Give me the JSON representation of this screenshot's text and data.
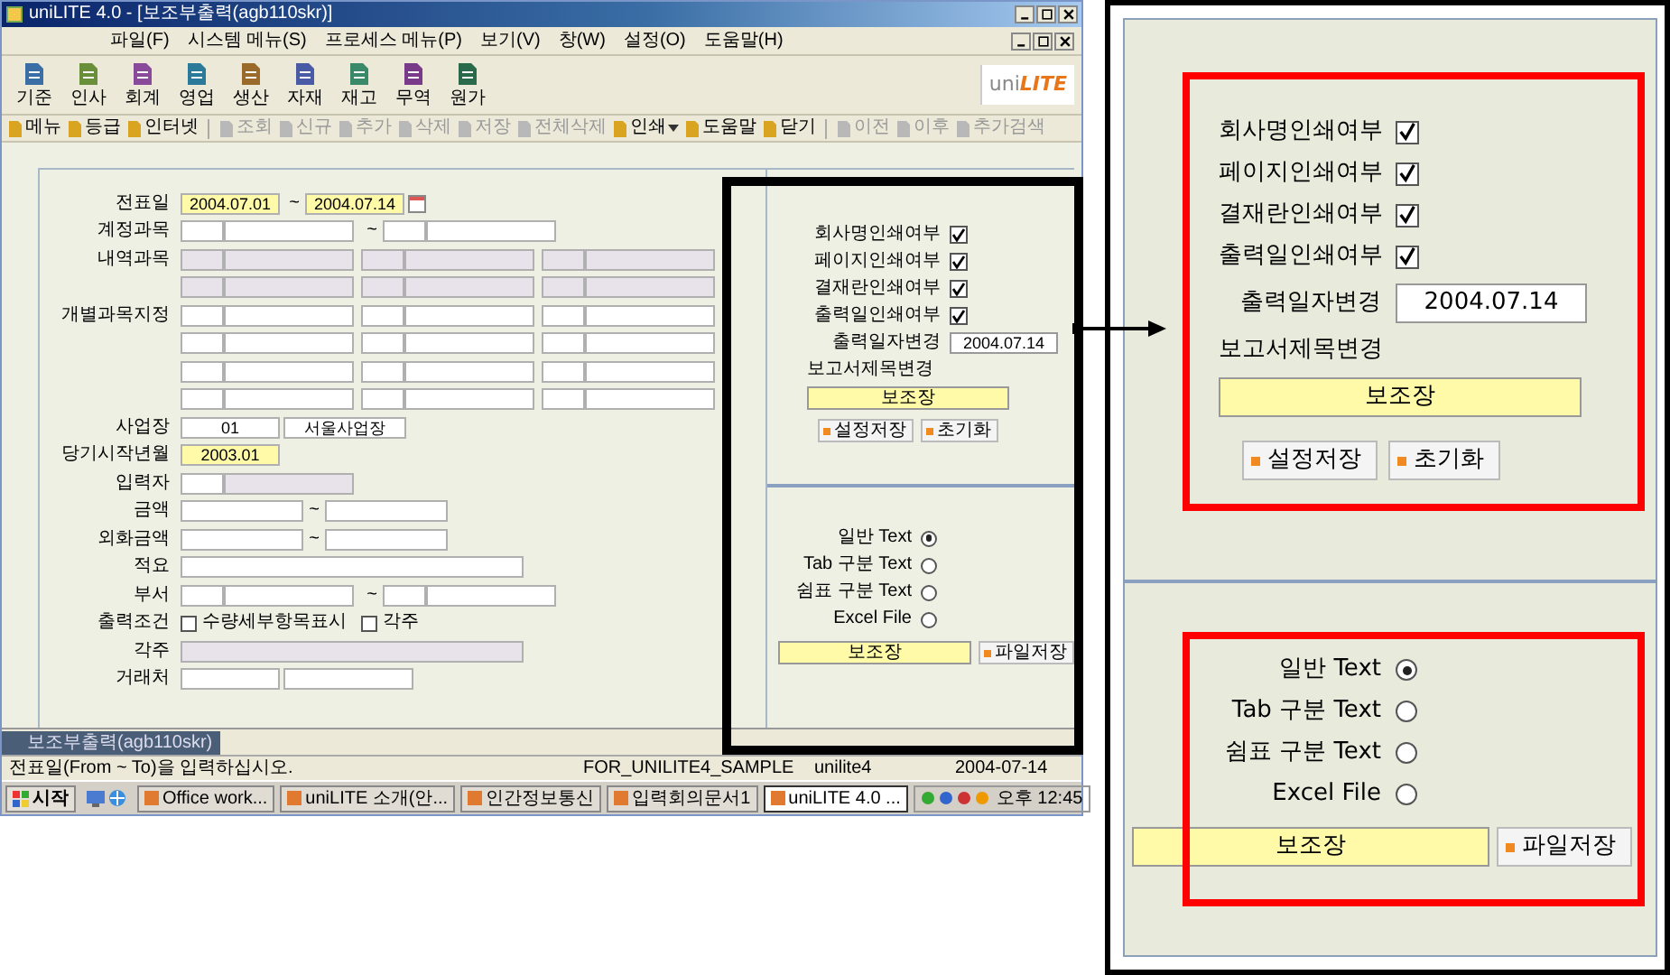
{
  "app_window": {
    "title": "uniLITE 4.0 - [보조부출력(agb110skr)]",
    "menu": [
      "파일(F)",
      "시스템 메뉴(S)",
      "프로세스 메뉴(P)",
      "보기(V)",
      "창(W)",
      "설정(O)",
      "도움말(H)"
    ],
    "modules": [
      "기준",
      "인사",
      "회계",
      "영업",
      "생산",
      "자재",
      "재고",
      "무역",
      "원가"
    ],
    "logo": [
      "uni",
      "LITE"
    ],
    "toolbar": [
      {
        "kind": "button",
        "label": "메뉴",
        "disabled": false
      },
      {
        "kind": "button",
        "label": "등급",
        "disabled": false
      },
      {
        "kind": "button",
        "label": "인터넷",
        "disabled": false
      },
      {
        "kind": "separator"
      },
      {
        "kind": "button",
        "label": "조회",
        "disabled": true
      },
      {
        "kind": "button",
        "label": "신규",
        "disabled": true
      },
      {
        "kind": "button",
        "label": "추가",
        "disabled": true
      },
      {
        "kind": "button",
        "label": "삭제",
        "disabled": true
      },
      {
        "kind": "button",
        "label": "저장",
        "disabled": true
      },
      {
        "kind": "button",
        "label": "전체삭제",
        "disabled": true
      },
      {
        "kind": "dropdown",
        "label": "인쇄",
        "disabled": false
      },
      {
        "kind": "button",
        "label": "도움말",
        "disabled": false
      },
      {
        "kind": "button",
        "label": "닫기",
        "disabled": false
      },
      {
        "kind": "separator"
      },
      {
        "kind": "button",
        "label": "이전",
        "disabled": true
      },
      {
        "kind": "button",
        "label": "이후",
        "disabled": true
      },
      {
        "kind": "button",
        "label": "추가검색",
        "disabled": true
      }
    ],
    "form": {
      "rows": [
        {
          "label": "전표일",
          "items": [
            {
              "kind": "date",
              "value": "2004.07.01",
              "required": true
            },
            {
              "kind": "sep",
              "text": "~"
            },
            {
              "kind": "date",
              "value": "2004.07.14",
              "required": true
            },
            {
              "kind": "calendar"
            }
          ]
        },
        {
          "label": "계정과목",
          "items": [
            {
              "kind": "code"
            },
            {
              "kind": "name"
            },
            {
              "kind": "sep",
              "text": "~"
            },
            {
              "kind": "code"
            },
            {
              "kind": "name"
            }
          ]
        },
        {
          "label": "내역과목",
          "items": [
            {
              "kind": "code",
              "disabled": true
            },
            {
              "kind": "name",
              "disabled": true
            },
            {
              "kind": "code",
              "disabled": true
            },
            {
              "kind": "name",
              "disabled": true
            },
            {
              "kind": "code",
              "disabled": true
            },
            {
              "kind": "name",
              "disabled": true
            }
          ]
        },
        {
          "items": [
            {
              "kind": "code",
              "disabled": true
            },
            {
              "kind": "name",
              "disabled": true
            },
            {
              "kind": "code",
              "disabled": true
            },
            {
              "kind": "name",
              "disabled": true
            },
            {
              "kind": "code",
              "disabled": true
            },
            {
              "kind": "name",
              "disabled": true
            }
          ]
        },
        {
          "label": "개별과목지정",
          "items": [
            {
              "kind": "code"
            },
            {
              "kind": "name"
            },
            {
              "kind": "code"
            },
            {
              "kind": "name"
            },
            {
              "kind": "code"
            },
            {
              "kind": "name"
            }
          ]
        },
        {
          "items": [
            {
              "kind": "code"
            },
            {
              "kind": "name"
            },
            {
              "kind": "code"
            },
            {
              "kind": "name"
            },
            {
              "kind": "code"
            },
            {
              "kind": "name"
            }
          ]
        },
        {
          "items": [
            {
              "kind": "code"
            },
            {
              "kind": "name"
            },
            {
              "kind": "code"
            },
            {
              "kind": "name"
            },
            {
              "kind": "code"
            },
            {
              "kind": "name"
            }
          ]
        },
        {
          "items": [
            {
              "kind": "code"
            },
            {
              "kind": "name"
            },
            {
              "kind": "code"
            },
            {
              "kind": "name"
            },
            {
              "kind": "code"
            },
            {
              "kind": "name"
            }
          ]
        },
        {
          "label": "사업장",
          "items": [
            {
              "kind": "date",
              "value": "01"
            },
            {
              "kind": "amount",
              "value": "서울사업장"
            }
          ]
        },
        {
          "label": "당기시작년월",
          "items": [
            {
              "kind": "date",
              "value": "2003.01",
              "required": true
            }
          ]
        },
        {
          "label": "입력자",
          "items": [
            {
              "kind": "code"
            },
            {
              "kind": "name",
              "disabled": true
            }
          ]
        },
        {
          "label": "금액",
          "items": [
            {
              "kind": "amount"
            },
            {
              "kind": "sep",
              "text": "~"
            },
            {
              "kind": "amount"
            }
          ]
        },
        {
          "label": "외화금액",
          "items": [
            {
              "kind": "amount"
            },
            {
              "kind": "sep",
              "text": "~"
            },
            {
              "kind": "amount"
            }
          ]
        },
        {
          "label": "적요",
          "items": [
            {
              "kind": "wide"
            }
          ]
        },
        {
          "label": "부서",
          "items": [
            {
              "kind": "code"
            },
            {
              "kind": "name"
            },
            {
              "kind": "sep",
              "text": "~"
            },
            {
              "kind": "code"
            },
            {
              "kind": "name"
            }
          ]
        },
        {
          "label": "출력조건",
          "items": [
            {
              "kind": "check",
              "text": "수량세부항목표시",
              "checked": false
            },
            {
              "kind": "check",
              "text": "각주",
              "checked": false
            }
          ]
        },
        {
          "label": "각주",
          "items": [
            {
              "kind": "wide",
              "disabled": true
            }
          ]
        },
        {
          "label": "거래처",
          "items": [
            {
              "kind": "date"
            },
            {
              "kind": "name"
            }
          ]
        }
      ]
    },
    "print_options": {
      "checks": [
        {
          "label": "회사명인쇄여부",
          "checked": true
        },
        {
          "label": "페이지인쇄여부",
          "checked": true
        },
        {
          "label": "결재란인쇄여부",
          "checked": true
        },
        {
          "label": "출력일인쇄여부",
          "checked": true
        }
      ],
      "date_label": "출력일자변경",
      "date_value": "2004.07.14",
      "title_label": "보고서제목변경",
      "title_value": "보조장",
      "buttons": [
        "설정저장",
        "초기화"
      ]
    },
    "export_options": {
      "formats": [
        {
          "label": "일반 Text",
          "selected": true
        },
        {
          "label": "Tab 구분 Text",
          "selected": false
        },
        {
          "label": "쉼표 구분 Text",
          "selected": false
        },
        {
          "label": "Excel File",
          "selected": false
        }
      ],
      "file_value": "보조장",
      "button": "파일저장"
    },
    "document_tab": "보조부출력(agb110skr)",
    "status_bar": [
      "전표일(From ~ To)을 입력하십시오.",
      "FOR_UNILITE4_SAMPLE",
      "unilite4",
      "2004-07-14"
    ]
  },
  "taskbar": {
    "start": "시작",
    "items": [
      {
        "label": "Office work...",
        "selected": false
      },
      {
        "label": "uniLITE 소개(안...",
        "selected": false
      },
      {
        "label": "인간정보통신",
        "selected": false
      },
      {
        "label": "입력회의문서1",
        "selected": false
      },
      {
        "label": "uniLITE 4.0 ...",
        "selected": true
      }
    ],
    "clock": "오후 12:45"
  },
  "callout": {
    "print_options": {
      "checks": [
        {
          "label": "회사명인쇄여부",
          "checked": true
        },
        {
          "label": "페이지인쇄여부",
          "checked": true
        },
        {
          "label": "결재란인쇄여부",
          "checked": true
        },
        {
          "label": "출력일인쇄여부",
          "checked": true
        }
      ],
      "date_label": "출력일자변경",
      "date_value": "2004.07.14",
      "title_label": "보고서제목변경",
      "title_value": "보조장",
      "buttons": [
        "설정저장",
        "초기화"
      ]
    },
    "export_options": {
      "formats": [
        {
          "label": "일반 Text",
          "selected": true
        },
        {
          "label": "Tab 구분 Text",
          "selected": false
        },
        {
          "label": "쉼표 구분 Text",
          "selected": false
        },
        {
          "label": "Excel File",
          "selected": false
        }
      ],
      "file_value": "보조장",
      "button": "파일저장"
    }
  }
}
